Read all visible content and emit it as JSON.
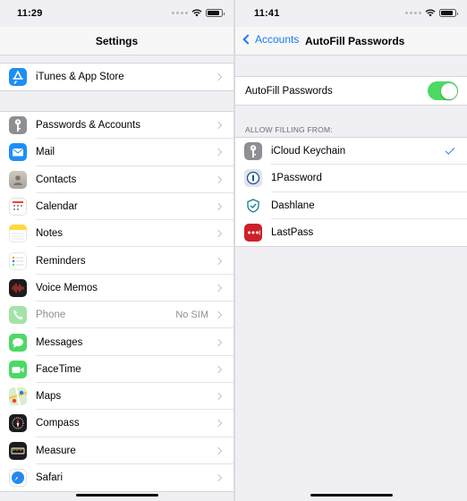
{
  "left_screen": {
    "status_time": "11:29",
    "title": "Settings",
    "group1": [
      {
        "icon": "app-store-icon",
        "label": "iTunes & App Store",
        "color": "#1e8ef5"
      }
    ],
    "group2": [
      {
        "icon": "key-icon",
        "label": "Passwords & Accounts",
        "color": "#8e8e93"
      },
      {
        "icon": "mail-icon",
        "label": "Mail",
        "color": "#1f8ff5"
      },
      {
        "icon": "contacts-icon",
        "label": "Contacts",
        "color": "#b8b2a8"
      },
      {
        "icon": "calendar-icon",
        "label": "Calendar",
        "color": "#ffffff"
      },
      {
        "icon": "notes-icon",
        "label": "Notes",
        "color": "#ffd93b"
      },
      {
        "icon": "reminders-icon",
        "label": "Reminders",
        "color": "#ffffff"
      },
      {
        "icon": "voice-memos-icon",
        "label": "Voice Memos",
        "color": "#1c1c1e"
      },
      {
        "icon": "phone-icon",
        "label": "Phone",
        "detail": "No SIM",
        "color": "#a4e3a8",
        "dimmed": true
      },
      {
        "icon": "messages-icon",
        "label": "Messages",
        "color": "#4cd964"
      },
      {
        "icon": "facetime-icon",
        "label": "FaceTime",
        "color": "#4cd964"
      },
      {
        "icon": "maps-icon",
        "label": "Maps",
        "color": "#d8eecf"
      },
      {
        "icon": "compass-icon",
        "label": "Compass",
        "color": "#1c1c1e"
      },
      {
        "icon": "measure-icon",
        "label": "Measure",
        "color": "#1c1c1e"
      },
      {
        "icon": "safari-icon",
        "label": "Safari",
        "color": "#ffffff"
      }
    ]
  },
  "right_screen": {
    "status_time": "11:41",
    "back_label": "Accounts",
    "title": "AutoFill Passwords",
    "toggle_row": {
      "label": "AutoFill Passwords",
      "on": true
    },
    "section_header": "ALLOW FILLING FROM:",
    "providers": [
      {
        "icon": "icloud-keychain-icon",
        "label": "iCloud Keychain",
        "selected": true
      },
      {
        "icon": "1password-icon",
        "label": "1Password",
        "selected": false
      },
      {
        "icon": "dashlane-icon",
        "label": "Dashlane",
        "selected": false
      },
      {
        "icon": "lastpass-icon",
        "label": "LastPass",
        "selected": false
      }
    ]
  },
  "colors": {
    "accent": "#1a7bf5",
    "toggle_on": "#4cd964"
  }
}
